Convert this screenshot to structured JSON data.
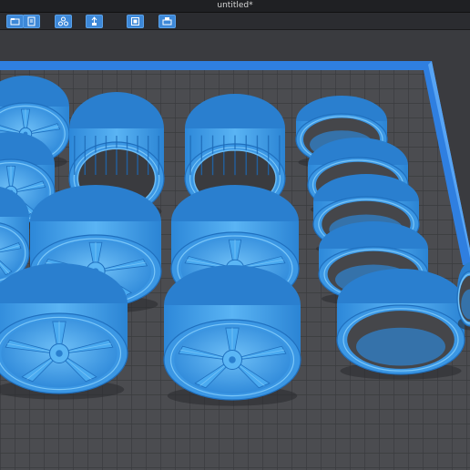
{
  "window": {
    "title": "untitled*"
  },
  "toolbar": {
    "buttons": [
      {
        "icon": "open-file-icon"
      },
      {
        "icon": "import-icon"
      },
      {
        "icon": "arrange-icon"
      },
      {
        "icon": "support-icon"
      },
      {
        "icon": "slice-icon"
      },
      {
        "icon": "print-icon"
      }
    ]
  },
  "viewport": {
    "bed_color": "#3c8cf0",
    "model_color": "#3fa2ea",
    "object_names": [
      "rim",
      "tire"
    ]
  }
}
